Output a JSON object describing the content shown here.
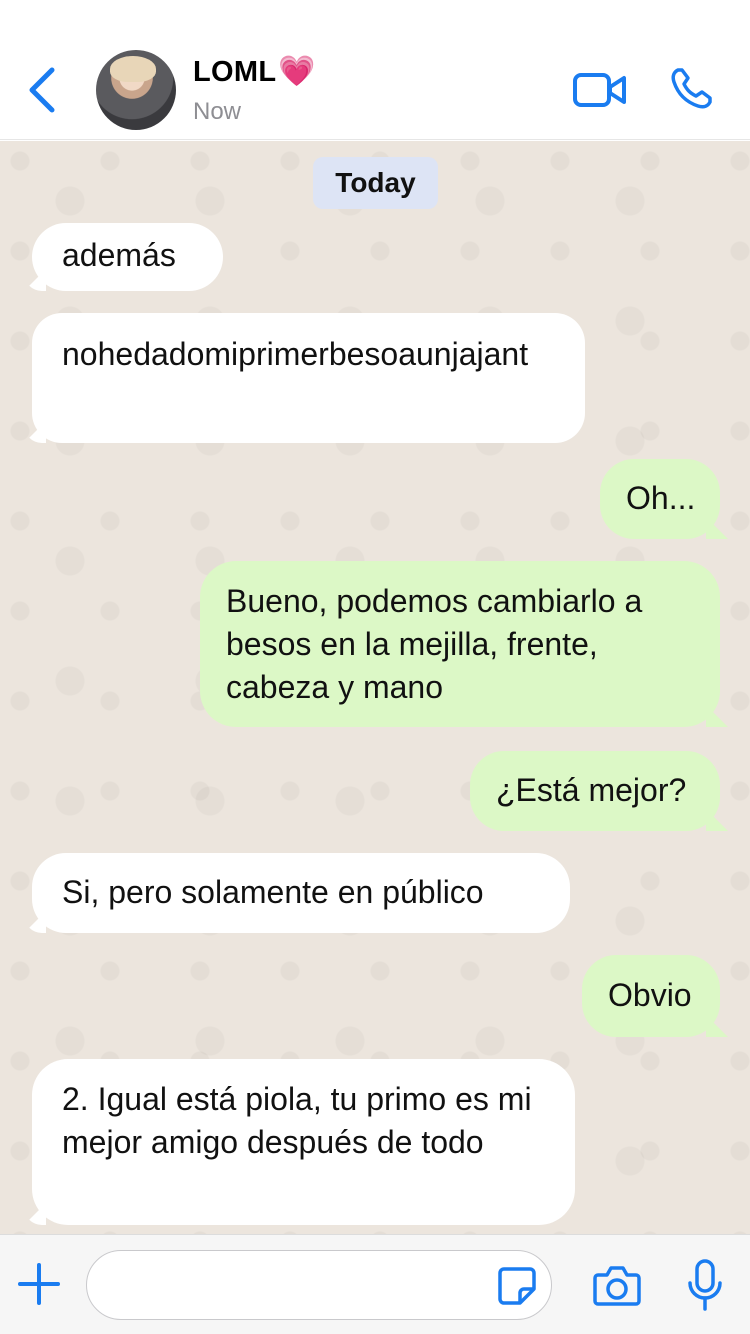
{
  "header": {
    "back_icon": "chevron-left-icon",
    "contact_name": "LOML",
    "heart_emoji": "💗",
    "status": "Now",
    "video_icon": "video-camera-icon",
    "call_icon": "phone-icon"
  },
  "chat": {
    "date_separator": "Today",
    "messages": [
      {
        "direction": "incoming",
        "text": "además"
      },
      {
        "direction": "incoming",
        "text": "nohedadomiprimerbesoaunjajant"
      },
      {
        "direction": "outgoing",
        "text": "Oh..."
      },
      {
        "direction": "outgoing",
        "text": "Bueno, podemos cambiarlo a besos en la mejilla, frente, cabeza y mano"
      },
      {
        "direction": "outgoing",
        "text": "¿Está mejor?"
      },
      {
        "direction": "incoming",
        "text": "Si, pero solamente en público"
      },
      {
        "direction": "outgoing",
        "text": "Obvio"
      },
      {
        "direction": "incoming",
        "text": "2. Igual está piola, tu primo es mi mejor amigo después de todo"
      }
    ]
  },
  "input_bar": {
    "plus_icon": "plus-icon",
    "message_value": "",
    "sticker_icon": "sticker-icon",
    "camera_icon": "camera-icon",
    "mic_icon": "microphone-icon"
  },
  "colors": {
    "accent": "#1a7cf0",
    "outgoing_bubble": "#dcf8c6",
    "incoming_bubble": "#ffffff",
    "chat_background": "#ece5dd",
    "date_chip": "#dde4f5"
  }
}
